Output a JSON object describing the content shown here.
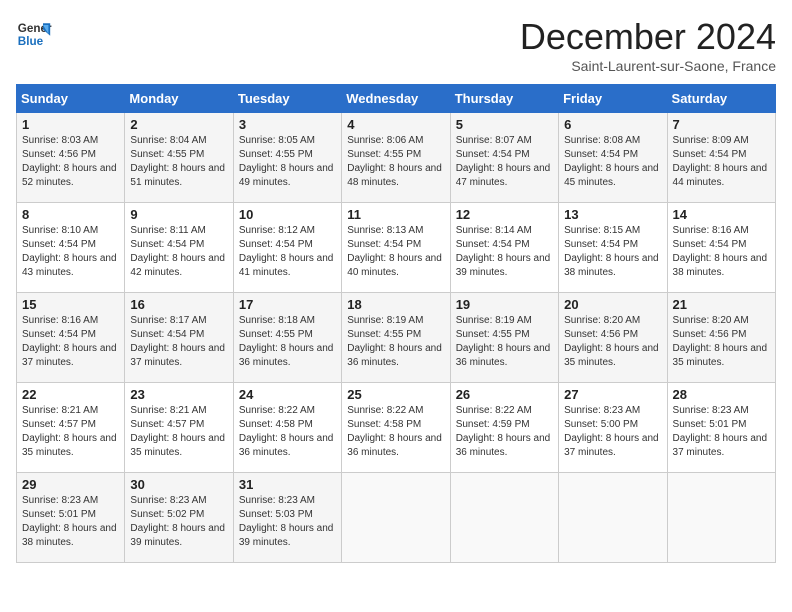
{
  "header": {
    "logo_line1": "General",
    "logo_line2": "Blue",
    "title": "December 2024",
    "location": "Saint-Laurent-sur-Saone, France"
  },
  "weekdays": [
    "Sunday",
    "Monday",
    "Tuesday",
    "Wednesday",
    "Thursday",
    "Friday",
    "Saturday"
  ],
  "weeks": [
    [
      {
        "day": "1",
        "sunrise": "Sunrise: 8:03 AM",
        "sunset": "Sunset: 4:56 PM",
        "daylight": "Daylight: 8 hours and 52 minutes."
      },
      {
        "day": "2",
        "sunrise": "Sunrise: 8:04 AM",
        "sunset": "Sunset: 4:55 PM",
        "daylight": "Daylight: 8 hours and 51 minutes."
      },
      {
        "day": "3",
        "sunrise": "Sunrise: 8:05 AM",
        "sunset": "Sunset: 4:55 PM",
        "daylight": "Daylight: 8 hours and 49 minutes."
      },
      {
        "day": "4",
        "sunrise": "Sunrise: 8:06 AM",
        "sunset": "Sunset: 4:55 PM",
        "daylight": "Daylight: 8 hours and 48 minutes."
      },
      {
        "day": "5",
        "sunrise": "Sunrise: 8:07 AM",
        "sunset": "Sunset: 4:54 PM",
        "daylight": "Daylight: 8 hours and 47 minutes."
      },
      {
        "day": "6",
        "sunrise": "Sunrise: 8:08 AM",
        "sunset": "Sunset: 4:54 PM",
        "daylight": "Daylight: 8 hours and 45 minutes."
      },
      {
        "day": "7",
        "sunrise": "Sunrise: 8:09 AM",
        "sunset": "Sunset: 4:54 PM",
        "daylight": "Daylight: 8 hours and 44 minutes."
      }
    ],
    [
      {
        "day": "8",
        "sunrise": "Sunrise: 8:10 AM",
        "sunset": "Sunset: 4:54 PM",
        "daylight": "Daylight: 8 hours and 43 minutes."
      },
      {
        "day": "9",
        "sunrise": "Sunrise: 8:11 AM",
        "sunset": "Sunset: 4:54 PM",
        "daylight": "Daylight: 8 hours and 42 minutes."
      },
      {
        "day": "10",
        "sunrise": "Sunrise: 8:12 AM",
        "sunset": "Sunset: 4:54 PM",
        "daylight": "Daylight: 8 hours and 41 minutes."
      },
      {
        "day": "11",
        "sunrise": "Sunrise: 8:13 AM",
        "sunset": "Sunset: 4:54 PM",
        "daylight": "Daylight: 8 hours and 40 minutes."
      },
      {
        "day": "12",
        "sunrise": "Sunrise: 8:14 AM",
        "sunset": "Sunset: 4:54 PM",
        "daylight": "Daylight: 8 hours and 39 minutes."
      },
      {
        "day": "13",
        "sunrise": "Sunrise: 8:15 AM",
        "sunset": "Sunset: 4:54 PM",
        "daylight": "Daylight: 8 hours and 38 minutes."
      },
      {
        "day": "14",
        "sunrise": "Sunrise: 8:16 AM",
        "sunset": "Sunset: 4:54 PM",
        "daylight": "Daylight: 8 hours and 38 minutes."
      }
    ],
    [
      {
        "day": "15",
        "sunrise": "Sunrise: 8:16 AM",
        "sunset": "Sunset: 4:54 PM",
        "daylight": "Daylight: 8 hours and 37 minutes."
      },
      {
        "day": "16",
        "sunrise": "Sunrise: 8:17 AM",
        "sunset": "Sunset: 4:54 PM",
        "daylight": "Daylight: 8 hours and 37 minutes."
      },
      {
        "day": "17",
        "sunrise": "Sunrise: 8:18 AM",
        "sunset": "Sunset: 4:55 PM",
        "daylight": "Daylight: 8 hours and 36 minutes."
      },
      {
        "day": "18",
        "sunrise": "Sunrise: 8:19 AM",
        "sunset": "Sunset: 4:55 PM",
        "daylight": "Daylight: 8 hours and 36 minutes."
      },
      {
        "day": "19",
        "sunrise": "Sunrise: 8:19 AM",
        "sunset": "Sunset: 4:55 PM",
        "daylight": "Daylight: 8 hours and 36 minutes."
      },
      {
        "day": "20",
        "sunrise": "Sunrise: 8:20 AM",
        "sunset": "Sunset: 4:56 PM",
        "daylight": "Daylight: 8 hours and 35 minutes."
      },
      {
        "day": "21",
        "sunrise": "Sunrise: 8:20 AM",
        "sunset": "Sunset: 4:56 PM",
        "daylight": "Daylight: 8 hours and 35 minutes."
      }
    ],
    [
      {
        "day": "22",
        "sunrise": "Sunrise: 8:21 AM",
        "sunset": "Sunset: 4:57 PM",
        "daylight": "Daylight: 8 hours and 35 minutes."
      },
      {
        "day": "23",
        "sunrise": "Sunrise: 8:21 AM",
        "sunset": "Sunset: 4:57 PM",
        "daylight": "Daylight: 8 hours and 35 minutes."
      },
      {
        "day": "24",
        "sunrise": "Sunrise: 8:22 AM",
        "sunset": "Sunset: 4:58 PM",
        "daylight": "Daylight: 8 hours and 36 minutes."
      },
      {
        "day": "25",
        "sunrise": "Sunrise: 8:22 AM",
        "sunset": "Sunset: 4:58 PM",
        "daylight": "Daylight: 8 hours and 36 minutes."
      },
      {
        "day": "26",
        "sunrise": "Sunrise: 8:22 AM",
        "sunset": "Sunset: 4:59 PM",
        "daylight": "Daylight: 8 hours and 36 minutes."
      },
      {
        "day": "27",
        "sunrise": "Sunrise: 8:23 AM",
        "sunset": "Sunset: 5:00 PM",
        "daylight": "Daylight: 8 hours and 37 minutes."
      },
      {
        "day": "28",
        "sunrise": "Sunrise: 8:23 AM",
        "sunset": "Sunset: 5:01 PM",
        "daylight": "Daylight: 8 hours and 37 minutes."
      }
    ],
    [
      {
        "day": "29",
        "sunrise": "Sunrise: 8:23 AM",
        "sunset": "Sunset: 5:01 PM",
        "daylight": "Daylight: 8 hours and 38 minutes."
      },
      {
        "day": "30",
        "sunrise": "Sunrise: 8:23 AM",
        "sunset": "Sunset: 5:02 PM",
        "daylight": "Daylight: 8 hours and 39 minutes."
      },
      {
        "day": "31",
        "sunrise": "Sunrise: 8:23 AM",
        "sunset": "Sunset: 5:03 PM",
        "daylight": "Daylight: 8 hours and 39 minutes."
      },
      null,
      null,
      null,
      null
    ]
  ]
}
